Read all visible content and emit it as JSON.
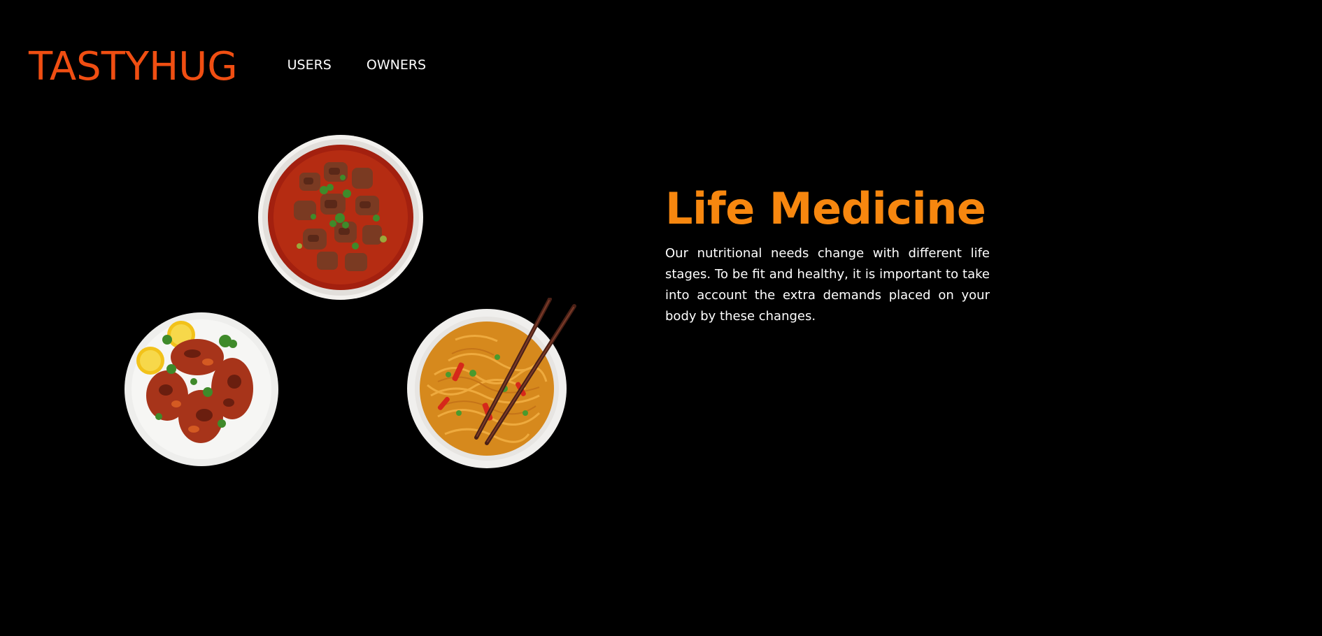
{
  "header": {
    "brand": "TASTYHUG",
    "nav": [
      {
        "label": "USERS"
      },
      {
        "label": "OWNERS"
      }
    ]
  },
  "hero": {
    "title": "Life Medicine",
    "body": "Our nutritional needs change with different life stages. To be fit and healthy, it is important to take into account the extra demands placed on your body by these changes."
  },
  "dishes": [
    {
      "name": "curry",
      "icon": "curry-bowl"
    },
    {
      "name": "chicken",
      "icon": "tandoori-chicken-plate"
    },
    {
      "name": "noodles",
      "icon": "noodles-bowl-chopsticks"
    }
  ],
  "colors": {
    "background": "#000000",
    "brand": "#f04e12",
    "title": "#f7870f",
    "text": "#ffffff"
  }
}
